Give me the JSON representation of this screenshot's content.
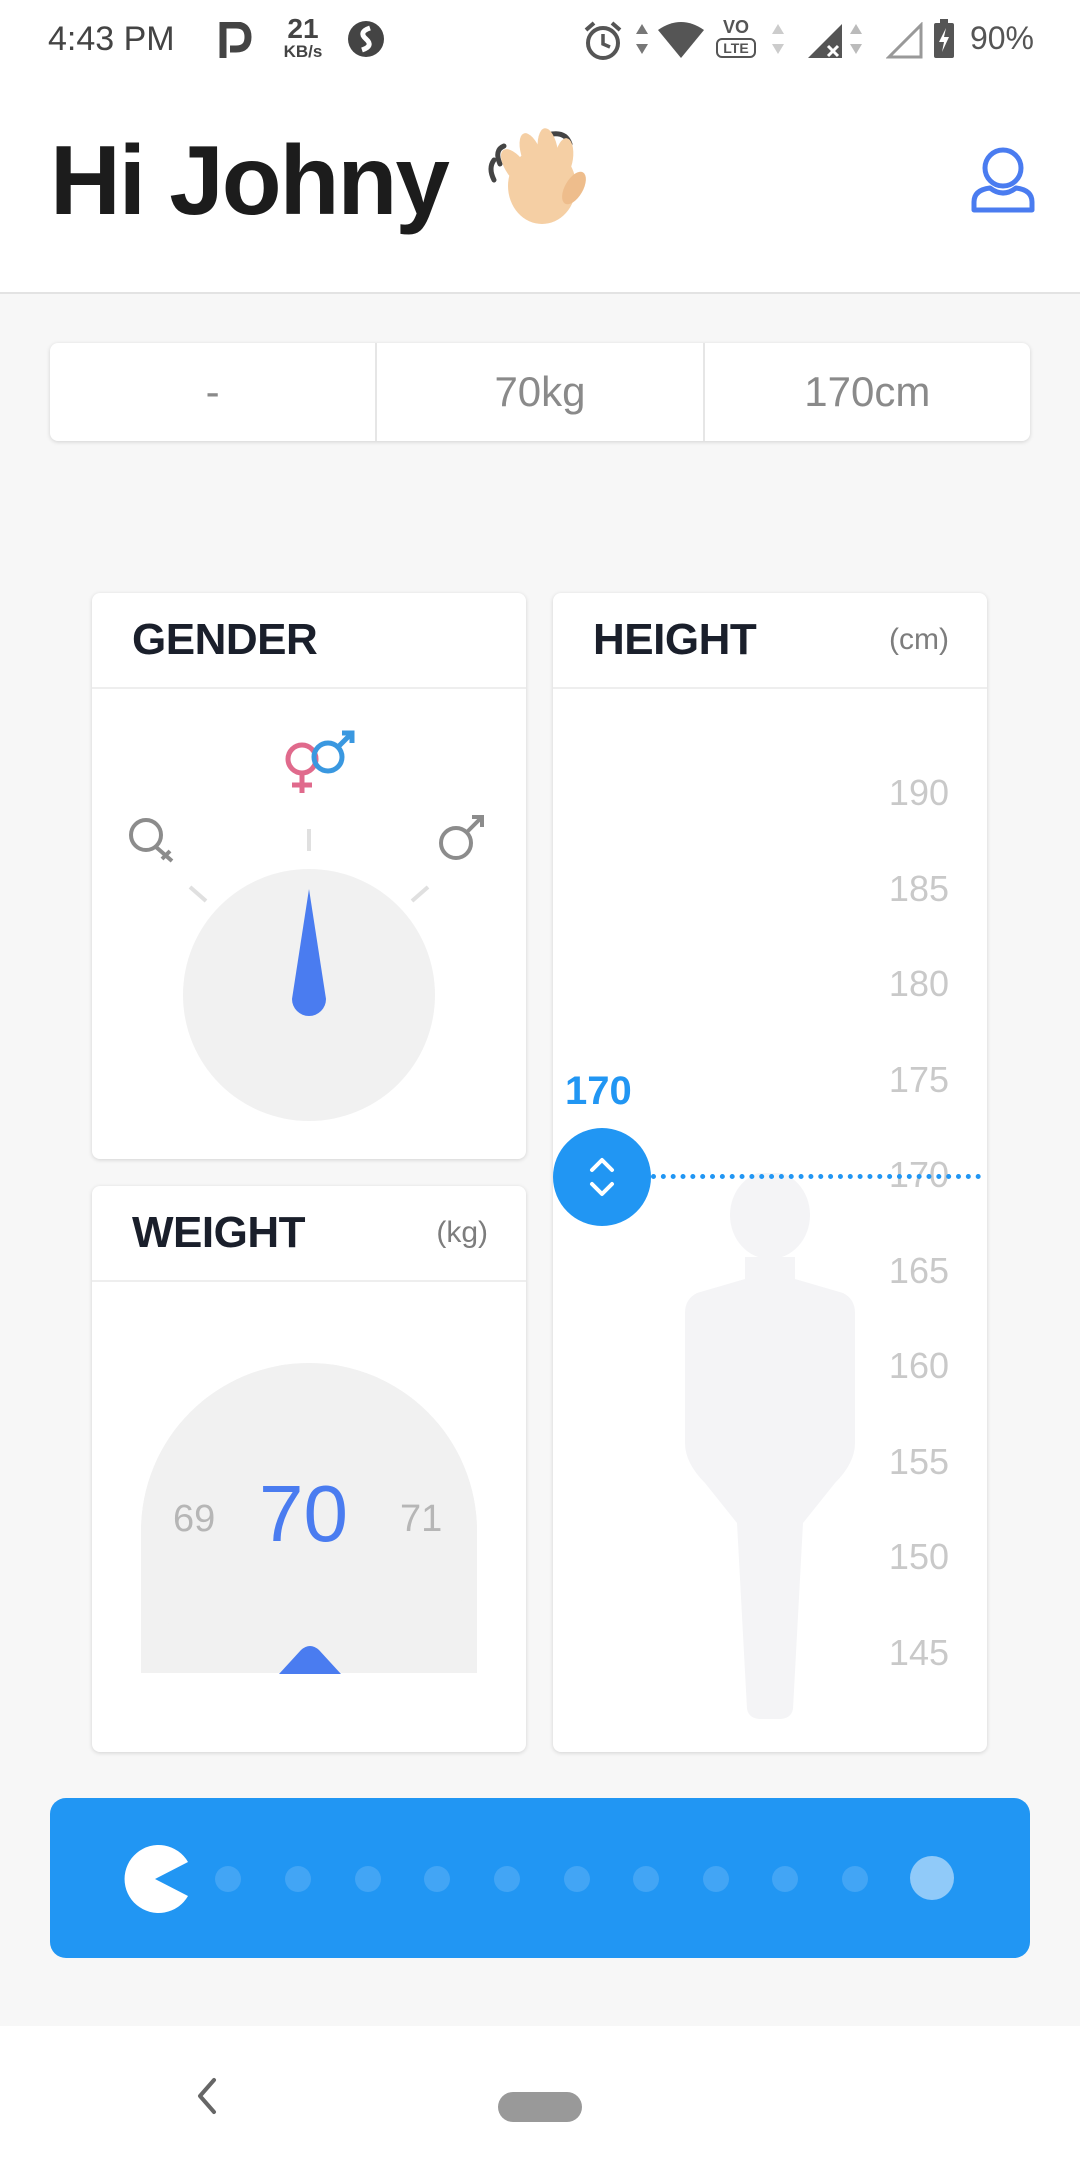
{
  "status_bar": {
    "time": "4:43 PM",
    "net_speed_value": "21",
    "net_speed_unit": "KB/s",
    "volte": "VO",
    "lte": "LTE",
    "battery": "90%",
    "icons": [
      "parking-app-icon",
      "shazam-icon",
      "alarm-icon",
      "wifi-icon",
      "volte-icon",
      "signal-icon",
      "signal-empty-icon",
      "battery-charging-icon"
    ]
  },
  "header": {
    "greeting": "Hi Johny",
    "wave_icon": "waving-hand-icon",
    "profile_icon": "user-profile-icon"
  },
  "summary": {
    "gender": "-",
    "weight": "70kg",
    "height": "170cm"
  },
  "gender_card": {
    "title": "GENDER",
    "options": [
      "female",
      "both",
      "male"
    ],
    "selected": "both"
  },
  "weight_card": {
    "title": "WEIGHT",
    "unit": "(kg)",
    "prev": "69",
    "value": "70",
    "next": "71"
  },
  "height_card": {
    "title": "HEIGHT",
    "unit": "(cm)",
    "ticks": [
      "190",
      "185",
      "180",
      "175",
      "170",
      "165",
      "160",
      "155",
      "150",
      "145"
    ],
    "value": "170"
  },
  "progress": {
    "total_dots": 11,
    "current": 1
  },
  "colors": {
    "accent_blue": "#2196f3",
    "needle_blue": "#4a7cf0",
    "text_dark": "#1c1c1c"
  }
}
